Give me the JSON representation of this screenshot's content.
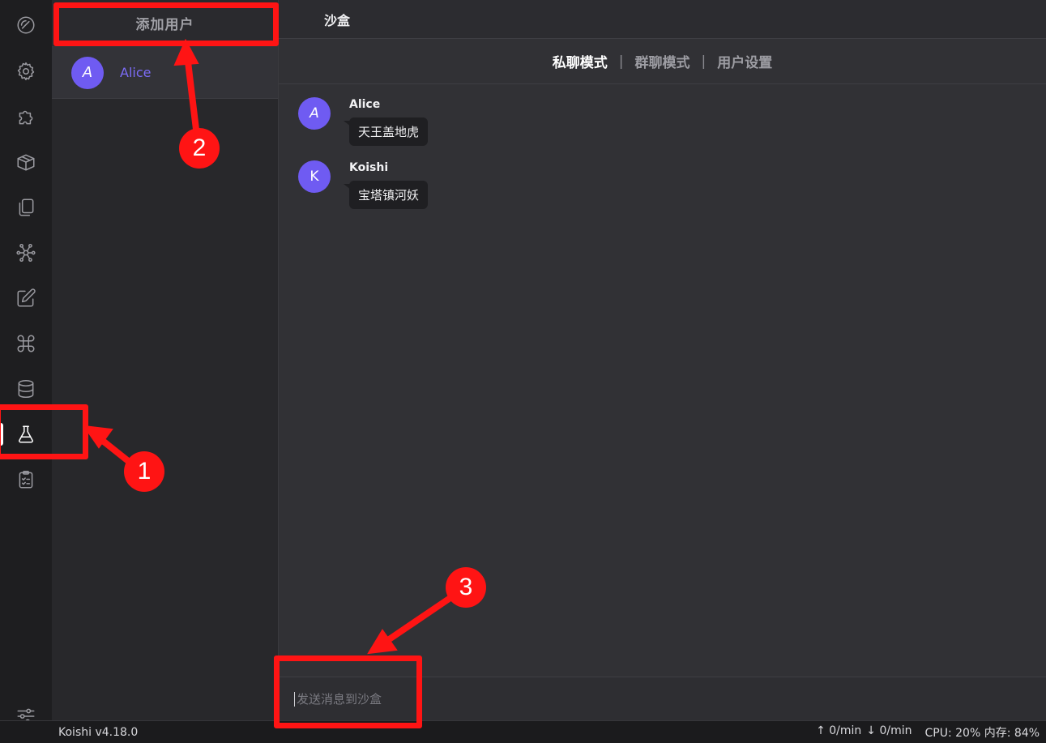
{
  "activity_bar": {
    "items": [
      {
        "icon": "dashboard-gauge-icon"
      },
      {
        "icon": "gear-icon"
      },
      {
        "icon": "puzzle-icon"
      },
      {
        "icon": "package-box-icon"
      },
      {
        "icon": "files-icon"
      },
      {
        "icon": "network-nodes-icon"
      },
      {
        "icon": "edit-pencil-icon"
      },
      {
        "icon": "command-key-icon"
      },
      {
        "icon": "database-icon"
      },
      {
        "icon": "flask-icon",
        "active": true
      },
      {
        "icon": "clipboard-check-icon"
      }
    ],
    "bottom_icon": "sliders-icon"
  },
  "users_panel": {
    "add_user_label": "添加用户",
    "users": [
      {
        "initial": "A",
        "name": "Alice"
      }
    ]
  },
  "main": {
    "title": "沙盒",
    "tabs": [
      {
        "label": "私聊模式",
        "active": true
      },
      {
        "label": "群聊模式",
        "active": false
      },
      {
        "label": "用户设置",
        "active": false
      }
    ],
    "separator": "|",
    "messages": [
      {
        "initial": "A",
        "author": "Alice",
        "text": "天王盖地虎"
      },
      {
        "initial": "K",
        "author": "Koishi",
        "text": "宝塔镇河妖"
      }
    ],
    "composer_placeholder": "发送消息到沙盒"
  },
  "statusbar": {
    "version": "Koishi v4.18.0",
    "upload_rate": "↑ 0/min",
    "download_rate": "↓ 0/min",
    "resources": "CPU: 20% 内存: 84%"
  },
  "annotations": {
    "color": "#ff1414",
    "badges": [
      "1",
      "2",
      "3"
    ]
  }
}
